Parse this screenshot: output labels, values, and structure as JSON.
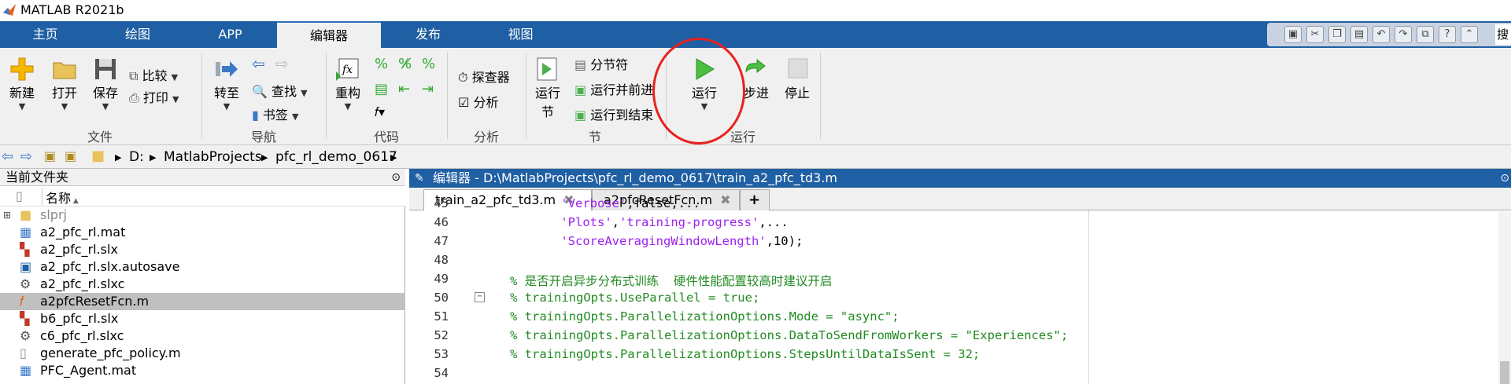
{
  "window": {
    "title": "MATLAB R2021b"
  },
  "tabs": [
    "主页",
    "绘图",
    "APP",
    "编辑器",
    "发布",
    "视图"
  ],
  "search_fragment": "搜",
  "ribbon": {
    "file": {
      "new": "新建",
      "open": "打开",
      "save": "保存",
      "compare": "比较",
      "print": "打印",
      "group": "文件"
    },
    "nav": {
      "goto": "转至",
      "find": "查找",
      "bookmark": "书签",
      "group": "导航"
    },
    "code": {
      "refactor": "重构",
      "group": "代码"
    },
    "analyze": {
      "explorer": "探查器",
      "analyze": "分析",
      "group": "分析"
    },
    "section": {
      "run_section_1": "运行",
      "run_section_2": "节",
      "section_break": "分节符",
      "run_advance": "运行并前进",
      "run_to_end": "运行到结束",
      "group": "节"
    },
    "run": {
      "run": "运行",
      "step": "步进",
      "stop": "停止",
      "group": "运行"
    }
  },
  "address": {
    "drive": "D:",
    "p1": "MatlabProjects",
    "p2": "pfc_rl_demo_0617"
  },
  "left_pane": {
    "title": "当前文件夹",
    "col_name": "名称",
    "files": [
      {
        "name": "slprj",
        "type": "folder"
      },
      {
        "name": "a2_pfc_rl.mat",
        "type": "mat"
      },
      {
        "name": "a2_pfc_rl.slx",
        "type": "slx"
      },
      {
        "name": "a2_pfc_rl.slx.autosave",
        "type": "autosave"
      },
      {
        "name": "a2_pfc_rl.slxc",
        "type": "slxc"
      },
      {
        "name": "a2pfcResetFcn.m",
        "type": "m",
        "selected": true
      },
      {
        "name": "b6_pfc_rl.slx",
        "type": "slx"
      },
      {
        "name": "c6_pfc_rl.slxc",
        "type": "slxc"
      },
      {
        "name": "generate_pfc_policy.m",
        "type": "m"
      },
      {
        "name": "PFC_Agent.mat",
        "type": "mat"
      }
    ]
  },
  "editor": {
    "title": "编辑器 - D:\\MatlabProjects\\pfc_rl_demo_0617\\train_a2_pfc_td3.m",
    "tabs": [
      {
        "label": "train_a2_pfc_td3.m",
        "active": true
      },
      {
        "label": "a2pfcResetFcn.m",
        "active": false
      }
    ],
    "add_tab": "+",
    "lines": [
      {
        "n": "45",
        "parts": [
          {
            "t": "    ",
            "c": ""
          },
          {
            "t": "'Verbose'",
            "c": "str"
          },
          {
            "t": ",false,...",
            "c": ""
          }
        ]
      },
      {
        "n": "46",
        "parts": [
          {
            "t": "    ",
            "c": ""
          },
          {
            "t": "'Plots'",
            "c": "str"
          },
          {
            "t": ",",
            "c": ""
          },
          {
            "t": "'training-progress'",
            "c": "str"
          },
          {
            "t": ",...",
            "c": ""
          }
        ]
      },
      {
        "n": "47",
        "parts": [
          {
            "t": "    ",
            "c": ""
          },
          {
            "t": "'ScoreAveragingWindowLength'",
            "c": "str"
          },
          {
            "t": ",10);",
            "c": ""
          }
        ]
      },
      {
        "n": "48",
        "parts": []
      },
      {
        "n": "49",
        "parts": [
          {
            "t": "% 是否开启异步分布式训练  硬件性能配置较高时建议开启",
            "c": "cmt"
          }
        ]
      },
      {
        "n": "50",
        "parts": [
          {
            "t": "% trainingOpts.UseParallel = true;",
            "c": "cmt"
          }
        ]
      },
      {
        "n": "51",
        "parts": [
          {
            "t": "% trainingOpts.ParallelizationOptions.Mode = \"async\";",
            "c": "cmt"
          }
        ]
      },
      {
        "n": "52",
        "parts": [
          {
            "t": "% trainingOpts.ParallelizationOptions.DataToSendFromWorkers = \"Experiences\";",
            "c": "cmt"
          }
        ]
      },
      {
        "n": "53",
        "parts": [
          {
            "t": "% trainingOpts.ParallelizationOptions.StepsUntilDataIsSent = 32;",
            "c": "cmt"
          }
        ]
      },
      {
        "n": "54",
        "parts": []
      }
    ]
  }
}
